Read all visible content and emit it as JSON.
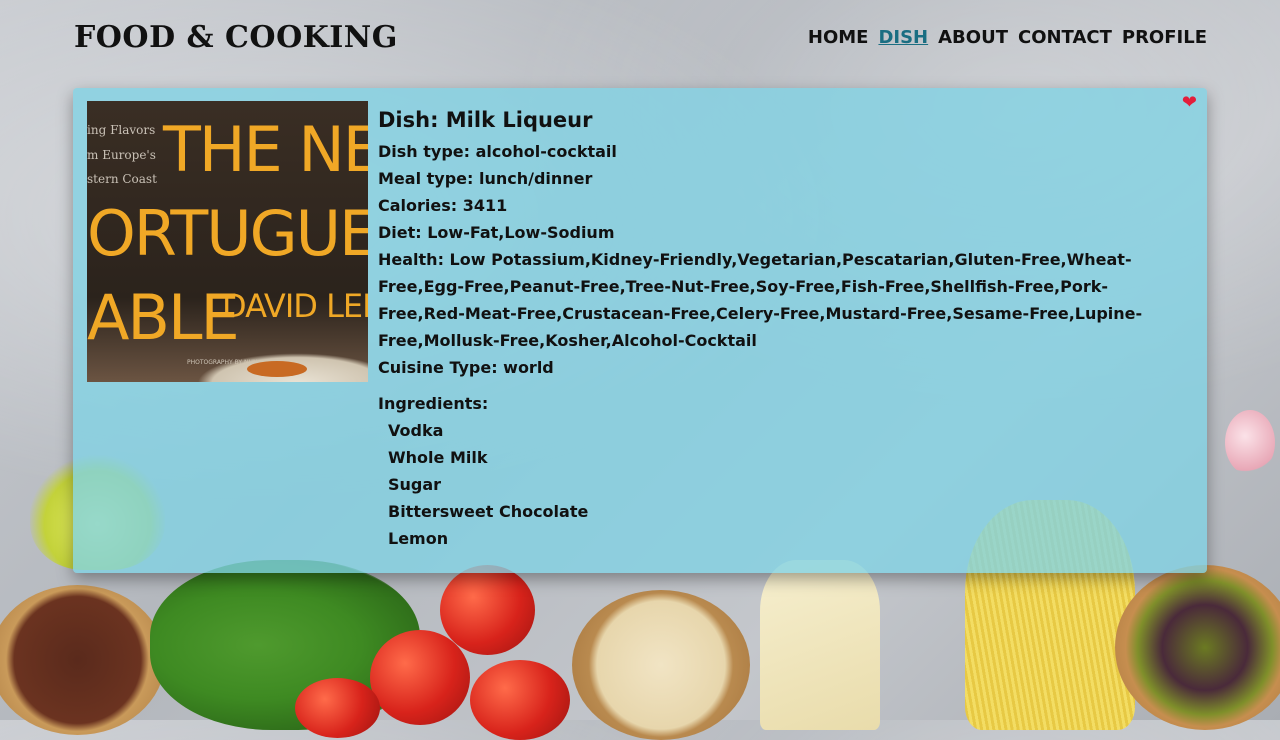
{
  "brand": "FOOD & COOKING",
  "nav": [
    {
      "label": "HOME",
      "active": false
    },
    {
      "label": "DISH",
      "active": true
    },
    {
      "label": "ABOUT",
      "active": false
    },
    {
      "label": "CONTACT",
      "active": false
    },
    {
      "label": "PROFILE",
      "active": false
    }
  ],
  "cover": {
    "subtitle_lines": [
      "ing Flavors",
      "m Europe's",
      "stern Coast"
    ],
    "title_lines": [
      "THE NEV",
      "ORTUGUES",
      "ABLE"
    ],
    "author": "DAVID LEI",
    "photo_credit": "PHOTOGRAPHY BY NUN"
  },
  "dish": {
    "title": "Dish: Milk Liqueur",
    "dish_type": "Dish type: alcohol-cocktail",
    "meal_type": "Meal type: lunch/dinner",
    "calories": "Calories: 3411",
    "diet": "Diet: Low-Fat,Low-Sodium",
    "health": "Health: Low Potassium,Kidney-Friendly,Vegetarian,Pescatarian,Gluten-Free,Wheat-Free,Egg-Free,Peanut-Free,Tree-Nut-Free,Soy-Free,Fish-Free,Shellfish-Free,Pork-Free,Red-Meat-Free,Crustacean-Free,Celery-Free,Mustard-Free,Sesame-Free,Lupine-Free,Mollusk-Free,Kosher,Alcohol-Cocktail",
    "cuisine": "Cuisine Type: world",
    "ingredients_label": "Ingredients:",
    "ingredients": [
      "Vodka",
      "Whole Milk",
      "Sugar",
      "Bittersweet Chocolate",
      "Lemon"
    ]
  },
  "icons": {
    "favorite": "heart-icon"
  },
  "colors": {
    "accent": "#1a6e82",
    "heart": "#e31e3b",
    "card": "#80d2e4"
  }
}
